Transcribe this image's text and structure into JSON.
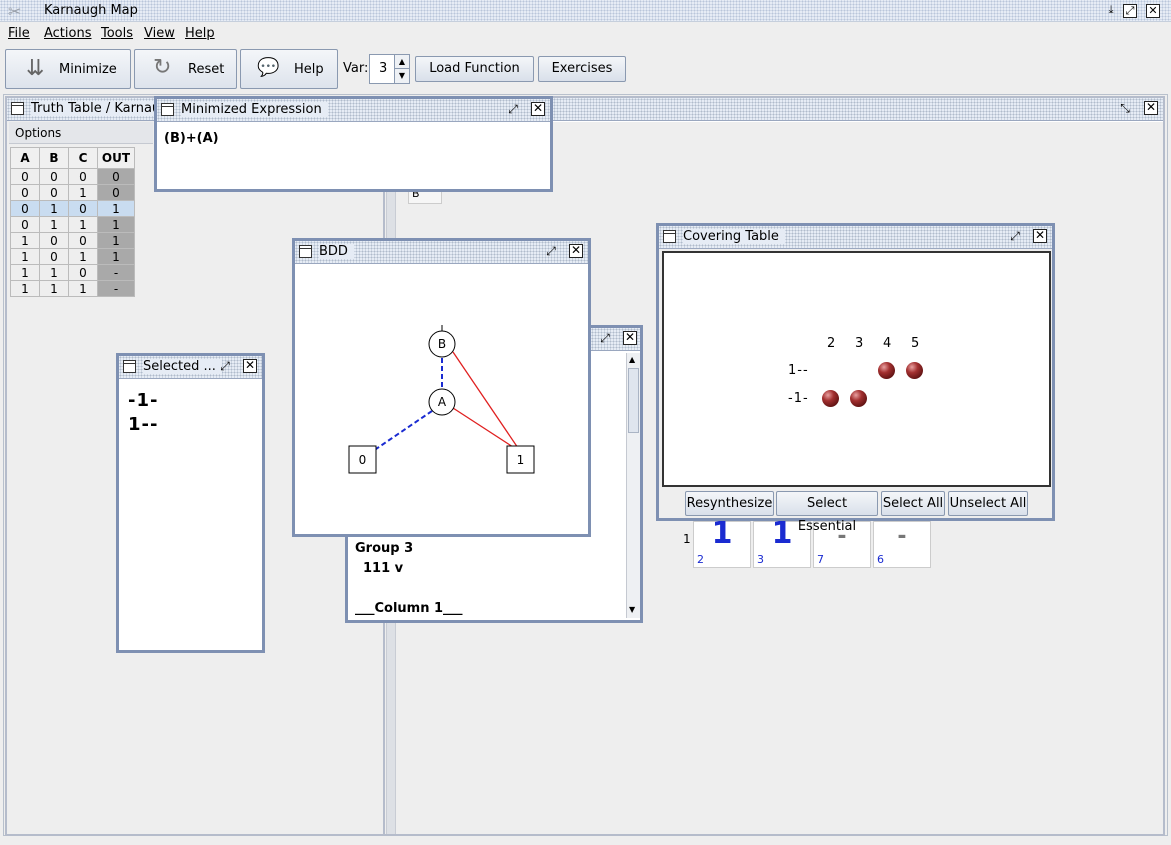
{
  "app": {
    "title": "Karnaugh Map",
    "menus": [
      "File",
      "Actions",
      "Tools",
      "View",
      "Help"
    ]
  },
  "toolbar": {
    "minimize": "Minimize",
    "reset": "Reset",
    "help": "Help",
    "var_label": "Var:",
    "var_value": "3",
    "load_function": "Load Function",
    "exercises": "Exercises"
  },
  "truth_table": {
    "title": "Truth Table / Karnau",
    "options": "Options",
    "headers": [
      "A",
      "B",
      "C",
      "OUT"
    ],
    "rows": [
      [
        "0",
        "0",
        "0",
        "0"
      ],
      [
        "0",
        "0",
        "1",
        "0"
      ],
      [
        "0",
        "1",
        "0",
        "1"
      ],
      [
        "0",
        "1",
        "1",
        "1"
      ],
      [
        "1",
        "0",
        "0",
        "1"
      ],
      [
        "1",
        "0",
        "1",
        "1"
      ],
      [
        "1",
        "1",
        "0",
        "-"
      ],
      [
        "1",
        "1",
        "1",
        "-"
      ]
    ]
  },
  "minimized": {
    "title": "Minimized Expression",
    "expression": "(B)+(A)"
  },
  "selected": {
    "title": "Selected ...",
    "items": [
      "-1-",
      "1--"
    ]
  },
  "bdd": {
    "title": "BDD",
    "nodes": [
      "B",
      "A",
      "0",
      "1"
    ]
  },
  "qm": {
    "group": "Group 3",
    "term": "111 v",
    "column": "___Column 1___"
  },
  "covering": {
    "title": "Covering Table",
    "columns": [
      "2",
      "3",
      "4",
      "5"
    ],
    "rows": [
      "1--",
      "-1-"
    ],
    "buttons": {
      "resynthesize": "Resynthesize",
      "select_essential": "Select Essential",
      "select_all": "Select All",
      "unselect_all": "Unselect All"
    }
  },
  "kmap": {
    "row_label": "1",
    "cells": [
      {
        "value": "1",
        "index": "2"
      },
      {
        "value": "1",
        "index": "3"
      },
      {
        "value": "-",
        "index": "7"
      },
      {
        "value": "-",
        "index": "6"
      }
    ],
    "partial_header": "B"
  },
  "colors": {
    "frame_border": "#7e90b2",
    "kmap_one": "#1a2bd1",
    "bdd_high": "#e02020",
    "bdd_low": "#1a2bd1",
    "selected_row": "#c9dcf0",
    "out_column": "#a9a9a9"
  }
}
